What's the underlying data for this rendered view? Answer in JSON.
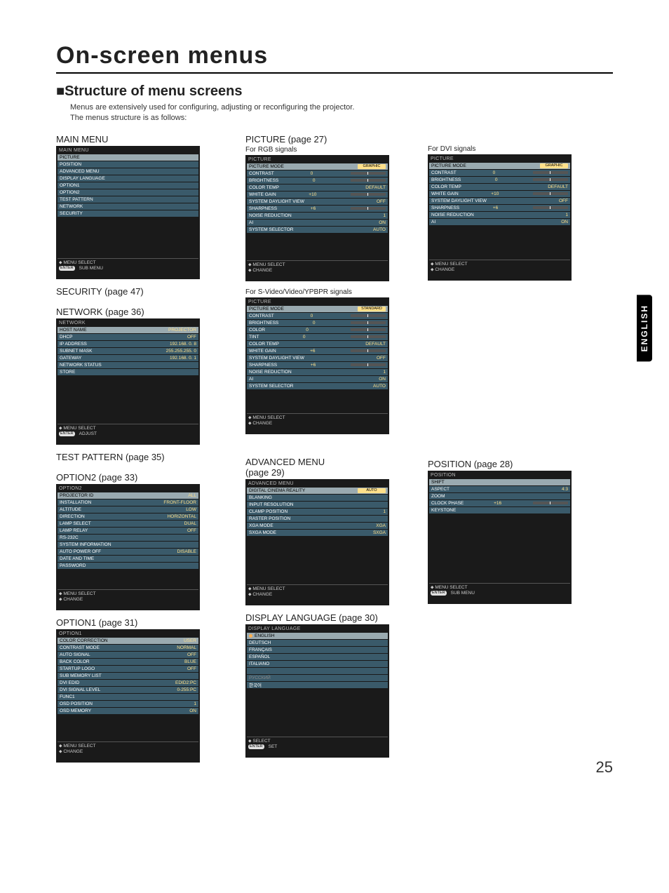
{
  "page_title": "On-screen menus",
  "subheading": "Structure of menu screens",
  "intro_line1": "Menus are extensively used for configuring, adjusting or reconfiguring the projector.",
  "intro_line2": "The menus structure is as follows:",
  "language_tab": "ENGLISH",
  "page_number": "25",
  "labels": {
    "main_menu": "MAIN MENU",
    "security": "SECURITY (page 47)",
    "network": "NETWORK (page 36)",
    "test_pattern": "TEST PATTERN (page 35)",
    "option2": "OPTION2 (page 33)",
    "option1": "OPTION1 (page 31)",
    "picture": "PICTURE (page 27)",
    "for_rgb": "For RGB signals",
    "for_svideo": "For S-Video/Video/YPBPR signals",
    "for_dvi": "For DVI signals",
    "adv_menu": "ADVANCED MENU",
    "adv_page": "(page 29)",
    "display_lang": "DISPLAY LANGUAGE (page 30)",
    "position": "POSITION (page 28)"
  },
  "footer": {
    "menu_select": "MENU SELECT",
    "sub_menu": "SUB MENU",
    "change": "CHANGE",
    "adjust": "ADJUST",
    "select": "SELECT",
    "set": "SET",
    "enter": "ENTER"
  },
  "main_menu_box": {
    "header": "MAIN MENU",
    "items": [
      {
        "l": "PICTURE",
        "hi": true
      },
      {
        "l": "POSITION"
      },
      {
        "l": "ADVANCED MENU"
      },
      {
        "l": "DISPLAY LANGUAGE"
      },
      {
        "l": "OPTION1"
      },
      {
        "l": "OPTION2"
      },
      {
        "l": "TEST PATTERN"
      },
      {
        "l": "NETWORK"
      },
      {
        "l": "SECURITY"
      }
    ]
  },
  "network_box": {
    "header": "NETWORK",
    "items": [
      {
        "l": "HOST NAME",
        "v": "PROJECTOR",
        "hi": true
      },
      {
        "l": "DHCP",
        "v": "OFF"
      },
      {
        "l": "IP ADDRESS",
        "v": "192.168.  0.  8"
      },
      {
        "l": "SUBNET MASK",
        "v": "255.255.255.  0"
      },
      {
        "l": "GATEWAY",
        "v": "192.168.  0.  1"
      },
      {
        "l": "NETWORK STATUS"
      },
      {
        "l": "STORE"
      }
    ]
  },
  "option2_box": {
    "header": "OPTION2",
    "items": [
      {
        "l": "PROJECTOR ID",
        "v": "ALL",
        "hi": true
      },
      {
        "l": "INSTALLATION",
        "v": "FRONT-FLOOR"
      },
      {
        "l": "ALTITUDE",
        "v": "LOW"
      },
      {
        "l": "DIRECTION",
        "v": "HORIZONTAL"
      },
      {
        "l": "LAMP SELECT",
        "v": "DUAL"
      },
      {
        "l": "LAMP RELAY",
        "v": "OFF"
      },
      {
        "l": "RS-232C"
      },
      {
        "l": "SYSTEM INFORMATION"
      },
      {
        "l": "AUTO POWER OFF",
        "v": "DISABLE"
      },
      {
        "l": "DATE AND TIME"
      },
      {
        "l": "PASSWORD"
      }
    ]
  },
  "option1_box": {
    "header": "OPTION1",
    "items": [
      {
        "l": "COLOR CORRECTION",
        "v": "USER",
        "hi": true
      },
      {
        "l": "CONTRAST MODE",
        "v": "NORMAL"
      },
      {
        "l": "AUTO SIGNAL",
        "v": "OFF"
      },
      {
        "l": "BACK COLOR",
        "v": "BLUE"
      },
      {
        "l": "STARTUP LOGO",
        "v": "OFF"
      },
      {
        "l": "SUB MEMORY LIST"
      },
      {
        "l": "DVI EDID",
        "v": "EDID2:PC"
      },
      {
        "l": "DVI SIGNAL LEVEL",
        "v": "0-255:PC"
      },
      {
        "l": "FUNC1"
      },
      {
        "l": "OSD POSITION",
        "v": "1"
      },
      {
        "l": "OSD MEMORY",
        "v": "ON"
      }
    ]
  },
  "picture_rgb_box": {
    "header": "PICTURE",
    "items": [
      {
        "l": "PICTURE MODE",
        "v": "GRAPHIC",
        "hi": true,
        "sel": true
      },
      {
        "l": "CONTRAST",
        "v": "0",
        "slider": true
      },
      {
        "l": "BRIGHTNESS",
        "v": "0",
        "slider": true
      },
      {
        "l": "COLOR TEMP",
        "v": "DEFAULT"
      },
      {
        "l": "WHITE GAIN",
        "v": "+10",
        "slider": true
      },
      {
        "l": "SYSTEM DAYLIGHT VIEW",
        "v": "OFF"
      },
      {
        "l": "SHARPNESS",
        "v": "+6",
        "slider": true
      },
      {
        "l": "NOISE REDUCTION",
        "v": "1"
      },
      {
        "l": "AI",
        "v": "ON"
      },
      {
        "l": "SYSTEM SELECTOR",
        "v": "AUTO"
      }
    ]
  },
  "picture_svideo_box": {
    "header": "PICTURE",
    "items": [
      {
        "l": "PICTURE MODE",
        "v": "STANDARD",
        "hi": true,
        "sel": true
      },
      {
        "l": "CONTRAST",
        "v": "0",
        "slider": true
      },
      {
        "l": "BRIGHTNESS",
        "v": "0",
        "slider": true
      },
      {
        "l": "COLOR",
        "v": "0",
        "slider": true
      },
      {
        "l": "TINT",
        "v": "0",
        "slider": true
      },
      {
        "l": "COLOR TEMP",
        "v": "DEFAULT"
      },
      {
        "l": "WHITE GAIN",
        "v": "+6",
        "slider": true
      },
      {
        "l": "SYSTEM DAYLIGHT VIEW",
        "v": "OFF"
      },
      {
        "l": "SHARPNESS",
        "v": "+6",
        "slider": true
      },
      {
        "l": "NOISE REDUCTION",
        "v": "1"
      },
      {
        "l": "AI",
        "v": "ON"
      },
      {
        "l": "SYSTEM SELECTOR",
        "v": "AUTO"
      }
    ]
  },
  "picture_dvi_box": {
    "header": "PICTURE",
    "items": [
      {
        "l": "PICTURE MODE",
        "v": "GRAPHIC",
        "hi": true,
        "sel": true
      },
      {
        "l": "CONTRAST",
        "v": "0",
        "slider": true
      },
      {
        "l": "BRIGHTNESS",
        "v": "0",
        "slider": true
      },
      {
        "l": "COLOR TEMP",
        "v": "DEFAULT"
      },
      {
        "l": "WHITE GAIN",
        "v": "+10",
        "slider": true
      },
      {
        "l": "SYSTEM DAYLIGHT VIEW",
        "v": "OFF"
      },
      {
        "l": "SHARPNESS",
        "v": "+6",
        "slider": true
      },
      {
        "l": "NOISE REDUCTION",
        "v": "1"
      },
      {
        "l": "AI",
        "v": "ON"
      }
    ]
  },
  "advanced_box": {
    "header": "ADVANCED MENU",
    "items": [
      {
        "l": "DIGITAL CINEMA REALITY",
        "v": "AUTO",
        "hi": true,
        "sel": true
      },
      {
        "l": "BLANKING"
      },
      {
        "l": "INPUT RESOLUTION"
      },
      {
        "l": "CLAMP POSITION",
        "v": "1"
      },
      {
        "l": "RASTER POSITION"
      },
      {
        "l": "XGA MODE",
        "v": "XGA"
      },
      {
        "l": "SXGA MODE",
        "v": "SXGA"
      }
    ]
  },
  "lang_box": {
    "header": "DISPLAY LANGUAGE",
    "items": [
      {
        "l": "ENGLISH",
        "dot": true,
        "hi": true
      },
      {
        "l": "DEUTSCH"
      },
      {
        "l": "FRANÇAIS"
      },
      {
        "l": "ESPAÑOL"
      },
      {
        "l": "ITALIANO"
      },
      {
        "l": ""
      },
      {
        "l": "РУССКИЙ",
        "grey": true
      },
      {
        "l": "한국어"
      }
    ]
  },
  "position_box": {
    "header": "POSITION",
    "items": [
      {
        "l": "SHIFT",
        "hi": true
      },
      {
        "l": "ASPECT",
        "v": "4:3"
      },
      {
        "l": "ZOOM"
      },
      {
        "l": "CLOCK PHASE",
        "v": "+16",
        "slider": true
      },
      {
        "l": "KEYSTONE"
      }
    ]
  }
}
